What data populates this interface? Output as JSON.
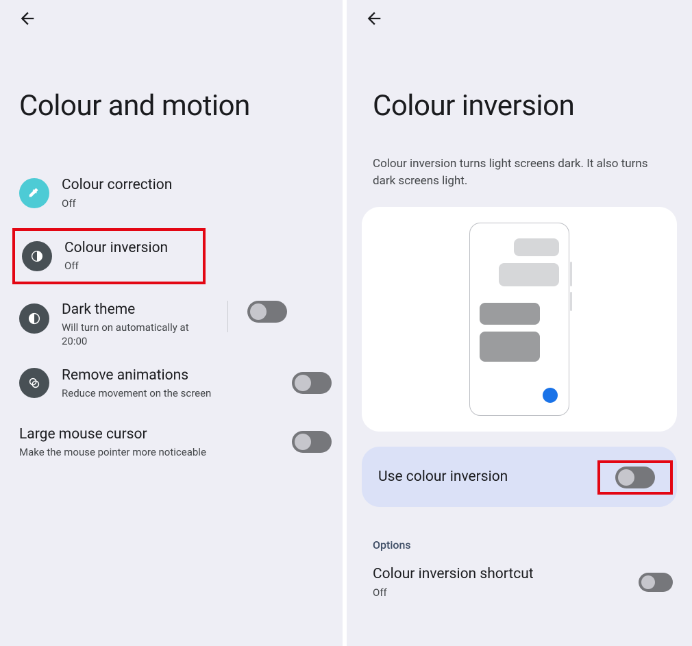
{
  "left": {
    "title": "Colour and motion",
    "items": {
      "colour_correction": {
        "title": "Colour correction",
        "sub": "Off"
      },
      "colour_inversion": {
        "title": "Colour inversion",
        "sub": "Off"
      },
      "dark_theme": {
        "title": "Dark theme",
        "sub": "Will turn on automatically at 20:00"
      },
      "remove_animations": {
        "title": "Remove animations",
        "sub": "Reduce movement on the screen"
      },
      "large_cursor": {
        "title": "Large mouse cursor",
        "sub": "Make the mouse pointer more noticeable"
      }
    }
  },
  "right": {
    "title": "Colour inversion",
    "description": "Colour inversion turns light screens dark. It also turns dark screens light.",
    "use_label": "Use colour inversion",
    "options_header": "Options",
    "shortcut": {
      "title": "Colour inversion shortcut",
      "sub": "Off"
    }
  }
}
